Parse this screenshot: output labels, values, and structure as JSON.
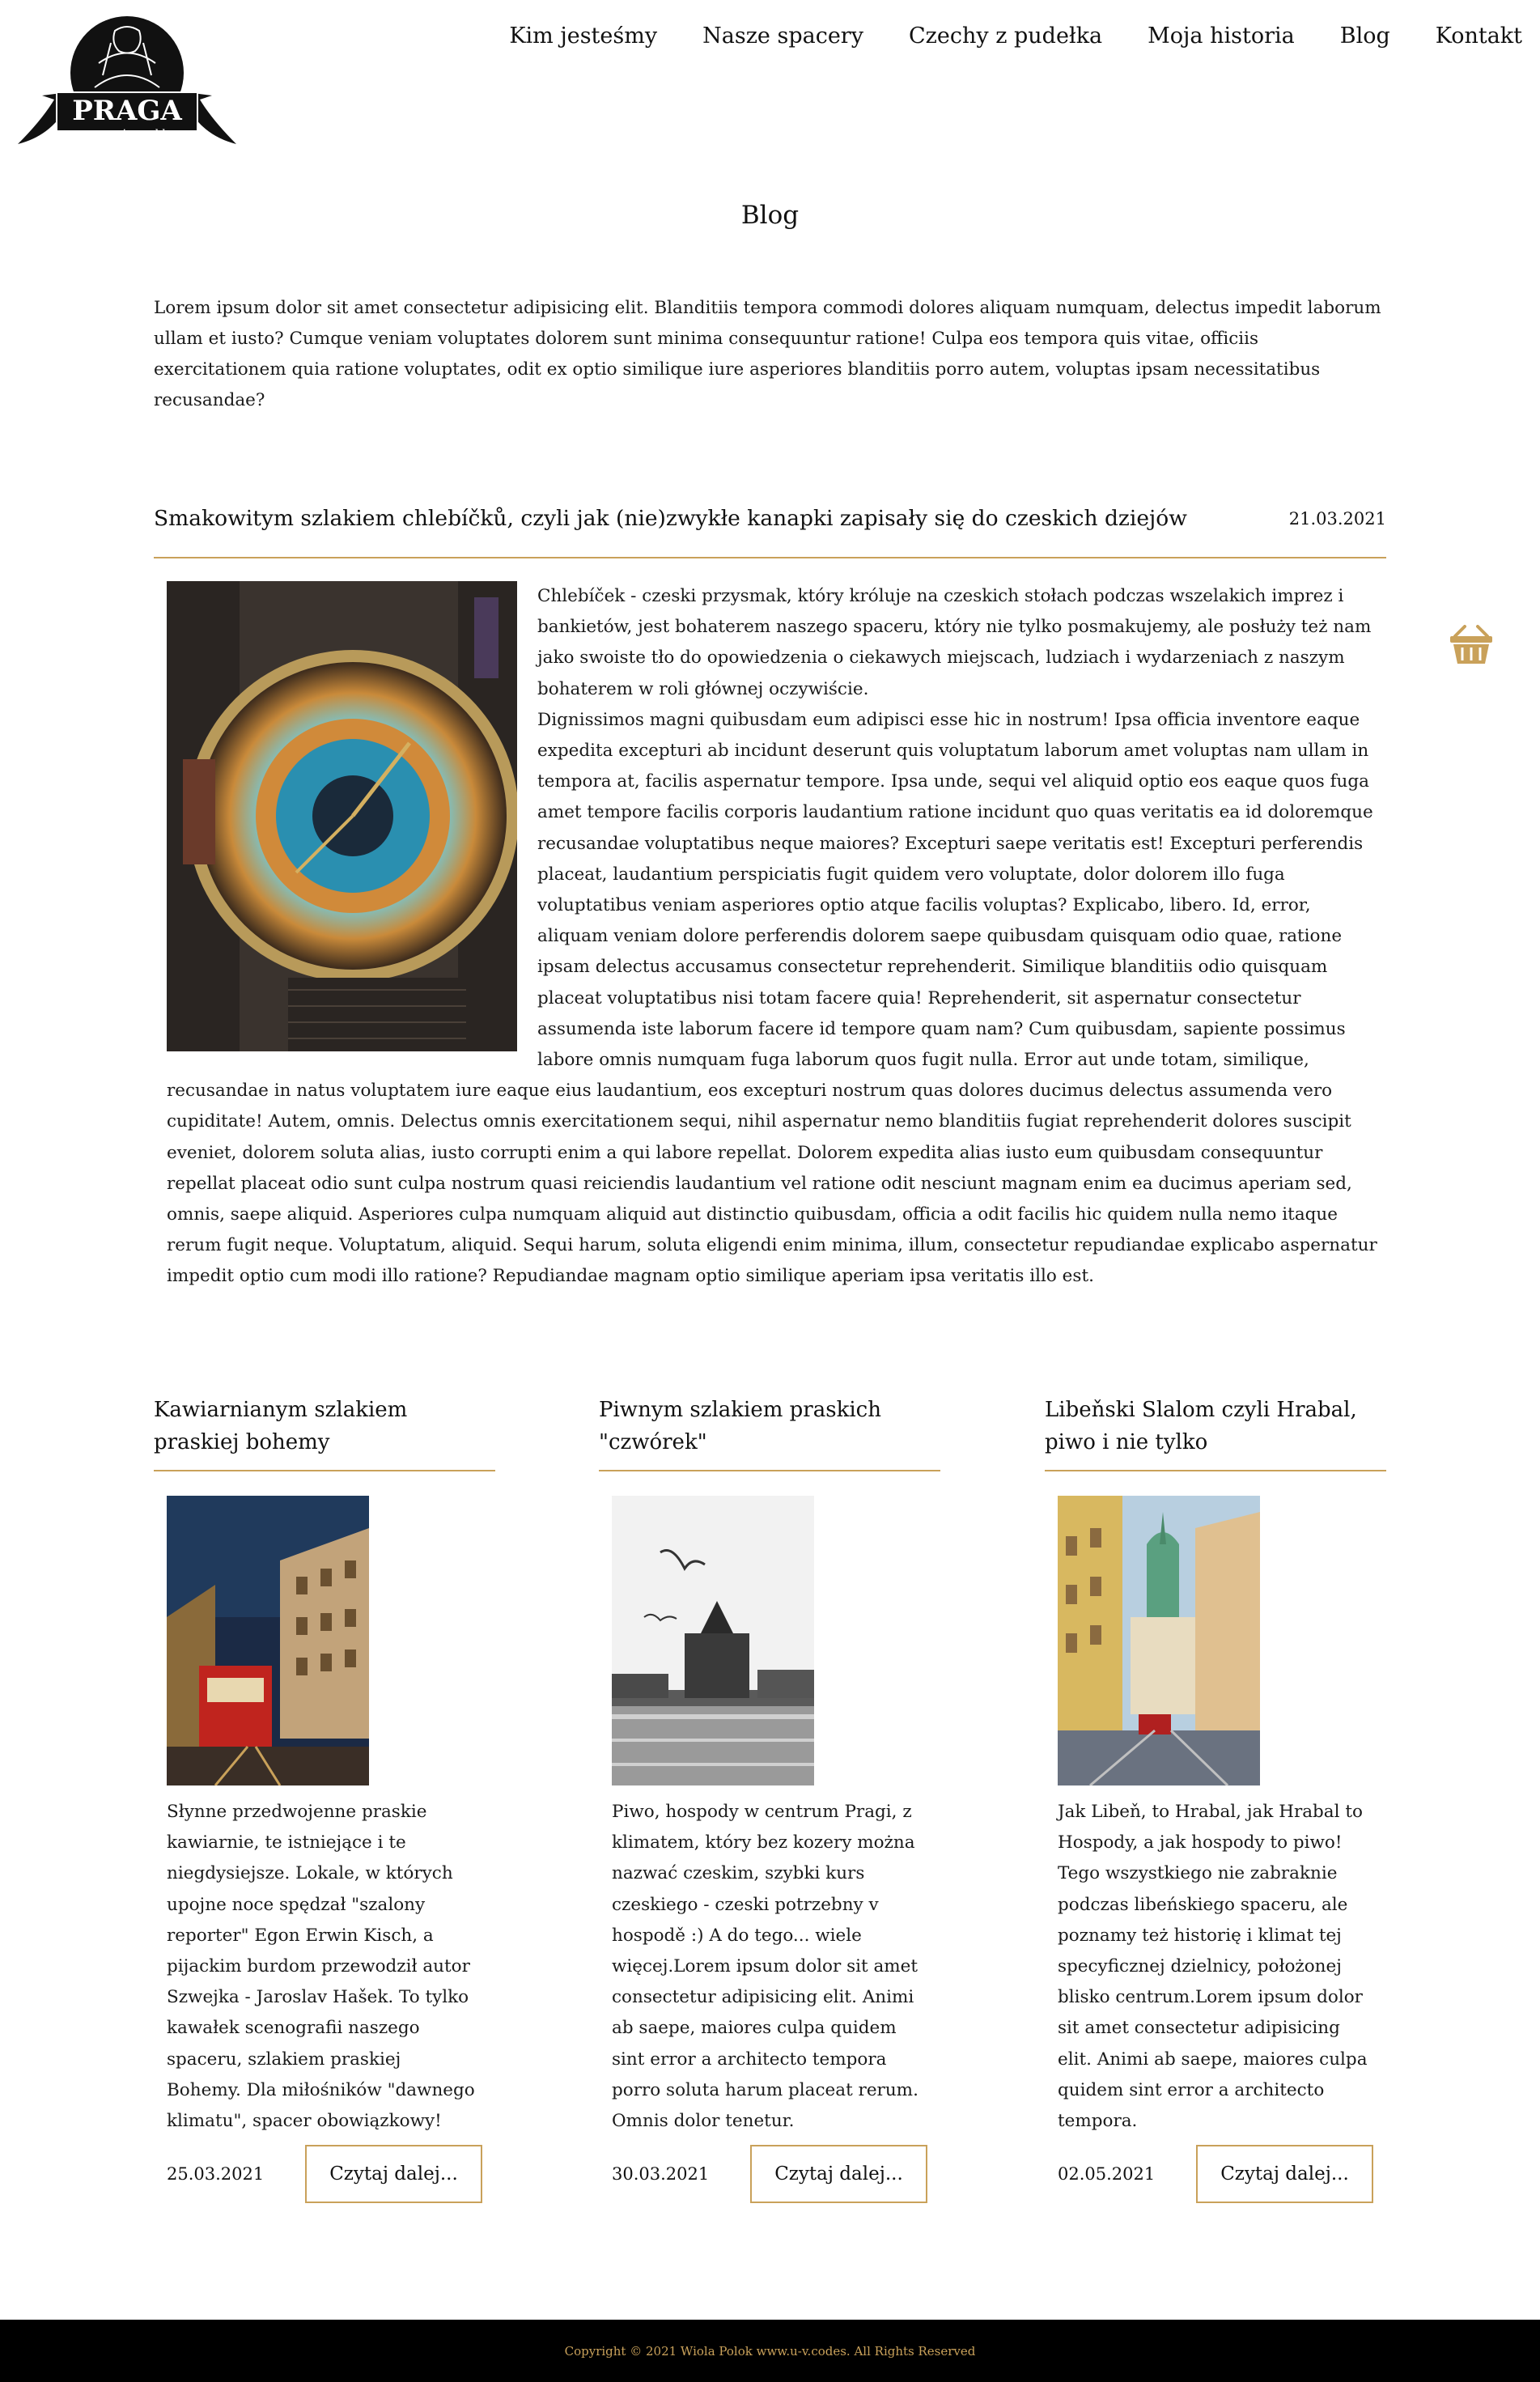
{
  "logo": {
    "main": "PRAGA",
    "sub": "niezwykła"
  },
  "nav": [
    {
      "label": "Kim jesteśmy"
    },
    {
      "label": "Nasze spacery"
    },
    {
      "label": "Czechy z pudełka"
    },
    {
      "label": "Moja historia"
    },
    {
      "label": "Blog"
    },
    {
      "label": "Kontakt"
    }
  ],
  "page": {
    "title": "Blog",
    "intro": "Lorem ipsum dolor sit amet consectetur adipisicing elit. Blanditiis tempora commodi dolores aliquam numquam, delectus impedit laborum ullam et iusto? Cumque veniam voluptates dolorem sunt minima consequuntur ratione! Culpa eos tempora quis vitae, officiis exercitationem quia ratione voluptates, odit ex optio similique iure asperiores blanditiis porro autem, voluptas ipsam necessitatibus recusandae?"
  },
  "featured": {
    "title": "Smakowitym szlakiem chlebíčků, czyli jak (nie)zwykłe kanapki zapisały się do czeskich dziejów",
    "date": "21.03.2021",
    "paragraph1": "Chlebíček - czeski przysmak, który króluje na czeskich stołach podczas wszelakich imprez i bankietów, jest bohaterem naszego spaceru, który nie tylko posmakujemy, ale posłuży też nam jako swoiste tło do opowiedzenia o ciekawych miejscach, ludziach i wydarzeniach z naszym bohaterem w roli głównej oczywiście.",
    "paragraph2": "Dignissimos magni quibusdam eum adipisci esse hic in nostrum! Ipsa officia inventore eaque expedita excepturi ab incidunt deserunt quis voluptatum laborum amet voluptas nam ullam in tempora at, facilis aspernatur tempore. Ipsa unde, sequi vel aliquid optio eos eaque quos fuga amet tempore facilis corporis laudantium ratione incidunt quo quas veritatis ea id doloremque recusandae voluptatibus neque maiores? Excepturi saepe veritatis est! Excepturi perferendis placeat, laudantium perspiciatis fugit quidem vero voluptate, dolor dolorem illo fuga voluptatibus veniam asperiores optio atque facilis voluptas? Explicabo, libero. Id, error, aliquam veniam dolore perferendis dolorem saepe quibusdam quisquam odio quae, ratione ipsam delectus accusamus consectetur reprehenderit. Similique blanditiis odio quisquam placeat voluptatibus nisi totam facere quia! Reprehenderit, sit aspernatur consectetur assumenda iste laborum facere id tempore quam nam? Cum quibusdam, sapiente possimus labore omnis numquam fuga laborum quos fugit nulla. Error aut unde totam, similique, recusandae in natus voluptatem iure eaque eius laudantium, eos excepturi nostrum quas dolores ducimus delectus assumenda vero cupiditate! Autem, omnis. Delectus omnis exercitationem sequi, nihil aspernatur nemo blanditiis fugiat reprehenderit dolores suscipit eveniet, dolorem soluta alias, iusto corrupti enim a qui labore repellat. Dolorem expedita alias iusto eum quibusdam consequuntur repellat placeat odio sunt culpa nostrum quasi reiciendis laudantium vel ratione odit nesciunt magnam enim ea ducimus aperiam sed, omnis, saepe aliquid. Asperiores culpa numquam aliquid aut distinctio quibusdam, officia a odit facilis hic quidem nulla nemo itaque rerum fugit neque. Voluptatum, aliquid. Sequi harum, soluta eligendi enim minima, illum, consectetur repudiandae explicabo aspernatur impedit optio cum modi illo ratione? Repudiandae magnam optio similique aperiam ipsa veritatis illo est."
  },
  "cards": [
    {
      "title": "Kawiarnianym szlakiem praskiej bohemy",
      "text": "Słynne przedwojenne praskie kawiarnie, te istniejące i te niegdysiejsze. Lokale, w których upojne noce spędzał \"szalony reporter\" Egon Erwin Kisch, a pijackim burdom przewodził autor Szwejka - Jaroslav Hašek. To tylko kawałek scenografii naszego spaceru, szlakiem praskiej Bohemy. Dla miłośników \"dawnego klimatu\", spacer obowiązkowy!",
      "date": "25.03.2021",
      "button": "Czytaj dalej..."
    },
    {
      "title": "Piwnym szlakiem praskich \"czwórek\"",
      "text": "Piwo, hospody w centrum Pragi, z klimatem, który bez kozery można nazwać czeskim, szybki kurs czeskiego - czeski potrzebny v hospodě :) A do tego... wiele więcej.Lorem ipsum dolor sit amet consectetur adipisicing elit. Animi ab saepe, maiores culpa quidem sint error a architecto tempora porro soluta harum placeat rerum. Omnis dolor tenetur.",
      "date": "30.03.2021",
      "button": "Czytaj dalej..."
    },
    {
      "title": "Libeňski Slalom czyli Hrabal, piwo i nie tylko",
      "text": "Jak Libeň, to Hrabal, jak Hrabal to Hospody, a jak hospody to piwo! Tego wszystkiego nie zabraknie podczas libeńskiego spaceru, ale poznamy też historię i klimat tej specyficznej dzielnicy, położonej blisko centrum.Lorem ipsum dolor sit amet consectetur adipisicing elit. Animi ab saepe, maiores culpa quidem sint error a architecto tempora.",
      "date": "02.05.2021",
      "button": "Czytaj dalej..."
    }
  ],
  "footer": {
    "copyright": "Copyright © 2021 Wiola Polok www.u-v.codes. All Rights Reserved"
  },
  "colors": {
    "accent": "#c9a15a",
    "footer_bg": "#000000",
    "text": "#1a1a1a"
  },
  "icons": {
    "cart": "basket-icon"
  }
}
